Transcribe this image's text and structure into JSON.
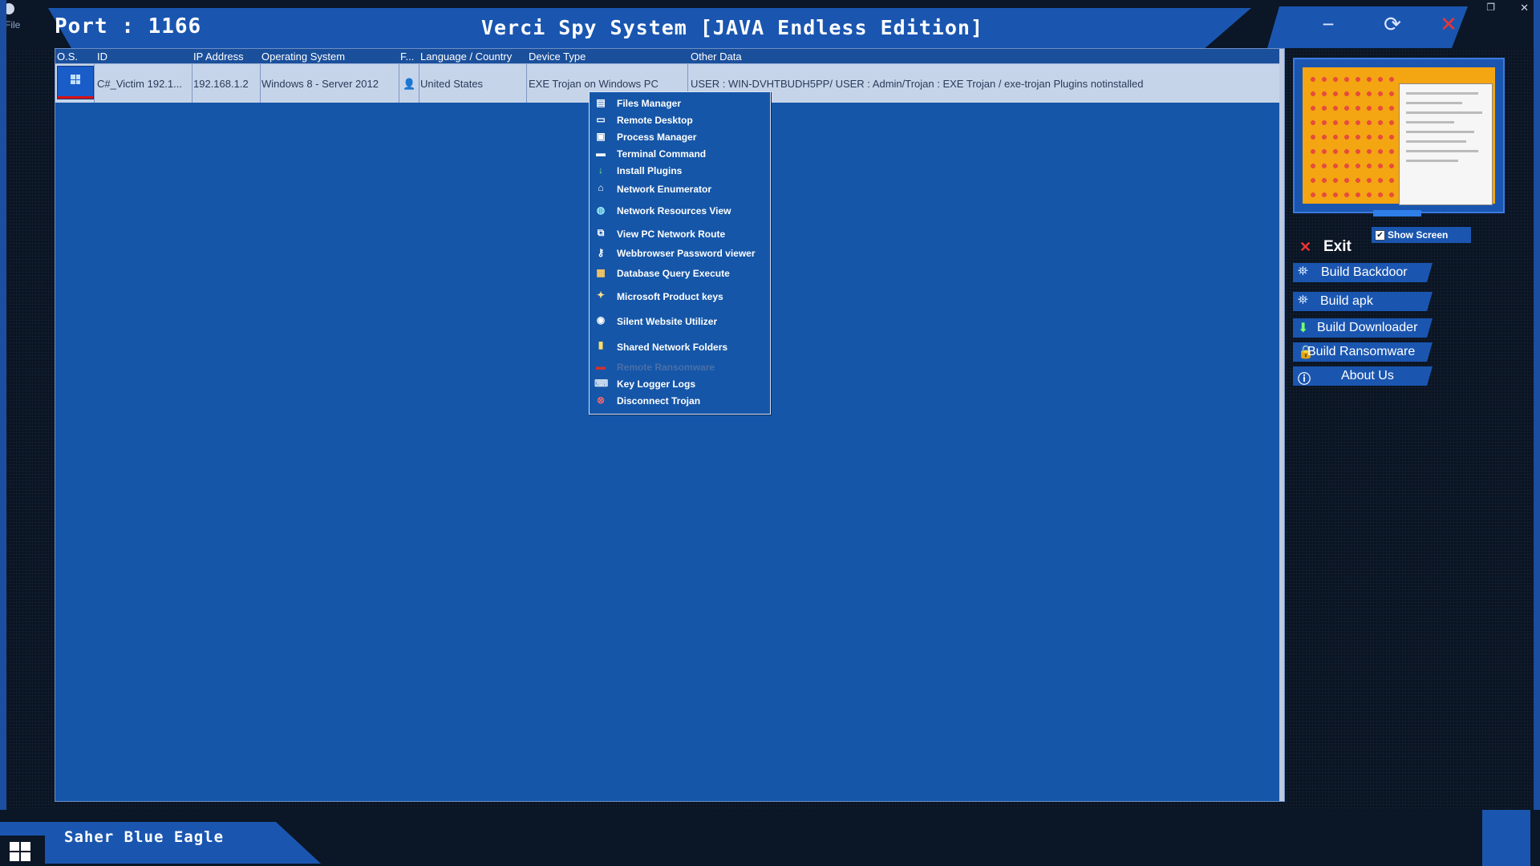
{
  "app": {
    "port_label": "Port : 1166",
    "title": "Verci Spy System [JAVA Endless Edition]",
    "menu_hint": "File",
    "footer": "Saher Blue Eagle"
  },
  "window_controls": {
    "minimize": "−",
    "restore": "⟳",
    "close": "✕"
  },
  "table": {
    "headers": [
      "O.S.",
      "ID",
      "IP Address",
      "Operating System",
      "F...",
      "Language / Country",
      "Device Type",
      "Other Data"
    ],
    "rows": [
      {
        "id": "C#_Victim 192.1...",
        "ip": "192.168.1.2",
        "os": "Windows 8 - Server 2012",
        "flag": "👤",
        "language": "United States",
        "device": "EXE Trojan on Windows PC",
        "other": "USER : WIN-DVHTBUDH5PP/ USER : Admin/Trojan : EXE Trojan / exe-trojan Plugins notinstalled"
      }
    ]
  },
  "context_menu": {
    "items": [
      {
        "label": "Files Manager",
        "icon": "folder-icon",
        "glyph": "▤"
      },
      {
        "label": "Remote Desktop",
        "icon": "monitor-icon",
        "glyph": "▭"
      },
      {
        "label": "Process Manager",
        "icon": "process-icon",
        "glyph": "▣"
      },
      {
        "label": "Terminal Command",
        "icon": "terminal-icon",
        "glyph": "▬"
      },
      {
        "label": "Install Plugins",
        "icon": "download-arrow-icon",
        "glyph": "↓"
      },
      {
        "label": "Network Enumerator",
        "icon": "network-icon",
        "glyph": "⌂"
      },
      {
        "label": "Network Resources View",
        "icon": "globe-icon",
        "glyph": "◍"
      },
      {
        "label": "View PC Network Route",
        "icon": "route-icon",
        "glyph": "⧉"
      },
      {
        "label": "Webbrowser Password viewer",
        "icon": "key-icon",
        "glyph": "⚷"
      },
      {
        "label": "Database Query Execute",
        "icon": "database-icon",
        "glyph": "▦"
      },
      {
        "label": "Microsoft Product keys",
        "icon": "product-key-icon",
        "glyph": "✦"
      },
      {
        "label": "Silent Website Utilizer",
        "icon": "camera-icon",
        "glyph": "◉"
      },
      {
        "label": "Shared Network Folders",
        "icon": "shared-folder-icon",
        "glyph": "▮"
      },
      {
        "label": "Remote Ransomware",
        "icon": "ransomware-icon",
        "glyph": "▬",
        "disabled": true
      },
      {
        "label": "Key Logger Logs",
        "icon": "keyboard-icon",
        "glyph": "⌨"
      },
      {
        "label": "Disconnect Trojan",
        "icon": "disconnect-icon",
        "glyph": "⊗"
      }
    ]
  },
  "side": {
    "show_screen_label": "Show Screen",
    "show_screen_checked": "✔",
    "exit_label": "Exit",
    "buttons": [
      {
        "label": "Build Backdoor",
        "icon": "backdoor-icon"
      },
      {
        "label": "Build apk",
        "icon": "apk-icon"
      },
      {
        "label": "Build Downloader",
        "icon": "downloader-icon"
      },
      {
        "label": "Build Ransomware",
        "icon": "ransomware-build-icon"
      },
      {
        "label": "About Us",
        "icon": "info-icon"
      }
    ]
  },
  "colors": {
    "accent": "#1a56b0",
    "panel": "#1556a8",
    "row_selected": "#c6d4ea"
  }
}
